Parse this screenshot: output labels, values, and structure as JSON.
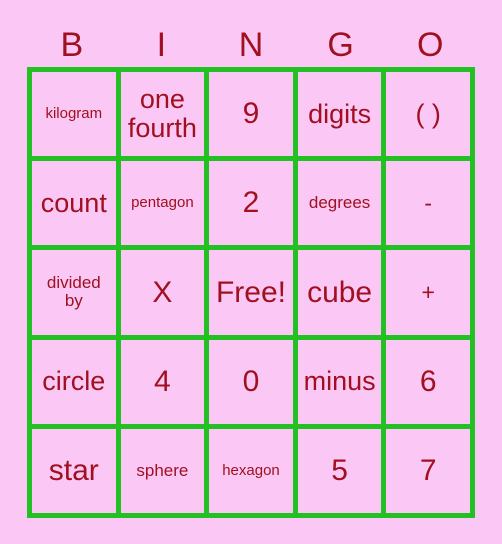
{
  "card": {
    "title": "BINGO",
    "colors": {
      "background": "#fbc8f5",
      "grid_line": "#22c022",
      "text": "#a01020"
    },
    "headers": [
      {
        "label": "B"
      },
      {
        "label": "I"
      },
      {
        "label": "N"
      },
      {
        "label": "G"
      },
      {
        "label": "O"
      }
    ],
    "rows": [
      {
        "cells": [
          {
            "text": "kilogram",
            "size": "xs",
            "free": false
          },
          {
            "text": "one\nfourth",
            "size": "lg",
            "free": false
          },
          {
            "text": "9",
            "size": "xl",
            "free": false
          },
          {
            "text": "digits",
            "size": "lg",
            "free": false
          },
          {
            "text": "( )",
            "size": "lg",
            "free": false
          }
        ]
      },
      {
        "cells": [
          {
            "text": "count",
            "size": "lg",
            "free": false
          },
          {
            "text": "pentagon",
            "size": "xs",
            "free": false
          },
          {
            "text": "2",
            "size": "xl",
            "free": false
          },
          {
            "text": "degrees",
            "size": "sm",
            "free": false
          },
          {
            "text": "-",
            "size": "md",
            "free": false
          }
        ]
      },
      {
        "cells": [
          {
            "text": "divided\nby",
            "size": "sm",
            "free": false
          },
          {
            "text": "X",
            "size": "xl",
            "free": false
          },
          {
            "text": "Free!",
            "size": "xl",
            "free": true
          },
          {
            "text": "cube",
            "size": "xl",
            "free": false
          },
          {
            "text": "+",
            "size": "md",
            "free": false
          }
        ]
      },
      {
        "cells": [
          {
            "text": "circle",
            "size": "lg",
            "free": false
          },
          {
            "text": "4",
            "size": "xl",
            "free": false
          },
          {
            "text": "0",
            "size": "xl",
            "free": false
          },
          {
            "text": "minus",
            "size": "lg",
            "free": false
          },
          {
            "text": "6",
            "size": "xl",
            "free": false
          }
        ]
      },
      {
        "cells": [
          {
            "text": "star",
            "size": "xl",
            "free": false
          },
          {
            "text": "sphere",
            "size": "sm",
            "free": false
          },
          {
            "text": "hexagon",
            "size": "xs",
            "free": false
          },
          {
            "text": "5",
            "size": "xl",
            "free": false
          },
          {
            "text": "7",
            "size": "xl",
            "free": false
          }
        ]
      }
    ]
  }
}
